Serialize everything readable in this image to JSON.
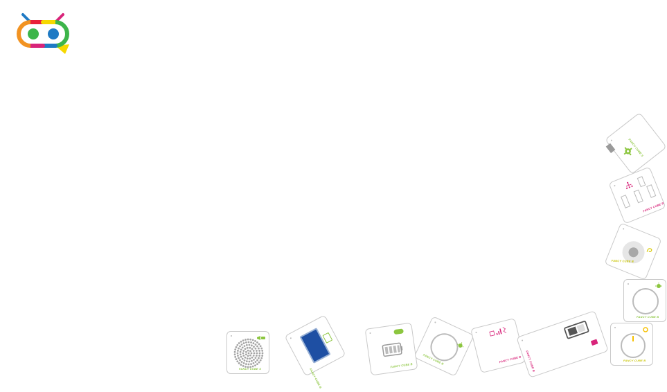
{
  "brand": {
    "logo_icon": "robot-face-logo-icon",
    "colors": {
      "red": "#e8223a",
      "yellow": "#f6d800",
      "green": "#3db54a",
      "blue": "#1f7ac4",
      "magenta": "#d8247a",
      "orange": "#f29322"
    }
  },
  "cubes": [
    {
      "id": "speaker",
      "label": "FANCY CUBE S",
      "label_color": "#8cc63f",
      "icon": "speaker-grille-icon"
    },
    {
      "id": "screen",
      "label": "FANCY CUBE B",
      "label_color": "#8cc63f",
      "icon": "blue-screen-icon"
    },
    {
      "id": "battery",
      "label": "FANCY CUBE B",
      "label_color": "#8cc63f",
      "icon": "battery-icon"
    },
    {
      "id": "light-ring",
      "label": "FANCY CUBE B",
      "label_color": "#8cc63f",
      "icon": "light-ring-icon"
    },
    {
      "id": "wireless",
      "label": "FANCY CUBE B",
      "label_color": "#d8247a",
      "icon": "wireless-signal-icon"
    },
    {
      "id": "power",
      "label": "FANCY CUBE B",
      "label_color": "#d8247a",
      "icon": "power-switch-icon"
    },
    {
      "id": "knob",
      "label": "FANCY CUBE B",
      "label_color": "#c8c400",
      "icon": "rotary-knob-icon"
    },
    {
      "id": "light-ring-2",
      "label": "FANCY CUBE B",
      "label_color": "#8cc63f",
      "icon": "light-ring-icon"
    },
    {
      "id": "sensor",
      "label": "FANCY CUBE B",
      "label_color": "#c8c400",
      "icon": "ear-sensor-icon"
    },
    {
      "id": "network",
      "label": "FANCY CUBE B",
      "label_color": "#d8247a",
      "icon": "network-hub-icon"
    },
    {
      "id": "gear",
      "label": "FANCY CUBE S",
      "label_color": "#8cc63f",
      "icon": "gear-icon"
    }
  ]
}
